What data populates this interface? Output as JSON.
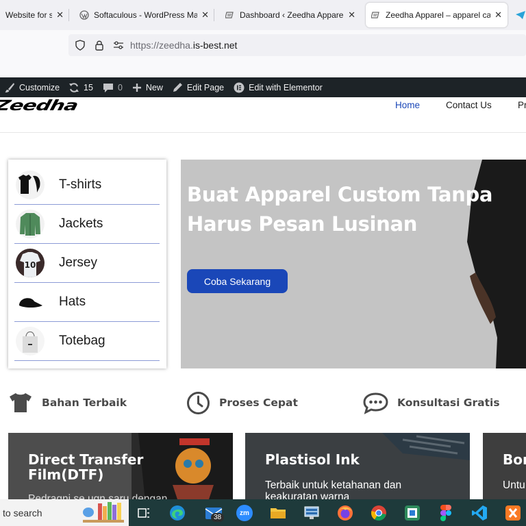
{
  "browser": {
    "tabs": [
      {
        "title": "Website for sketch",
        "favicon": "page-icon"
      },
      {
        "title": "Softaculous - WordPress Manage",
        "favicon": "wordpress-icon"
      },
      {
        "title": "Dashboard ‹ Zeedha Apparel",
        "favicon": "page-icon"
      },
      {
        "title": "Zeedha Apparel – apparel catalog",
        "favicon": "page-icon",
        "active": true
      }
    ],
    "close_glyph": "✕",
    "url_scheme": "https://zeedha.",
    "url_host": "is-best.net"
  },
  "wp_admin_bar": {
    "customize": "Customize",
    "updates_count": "15",
    "comments_count": "0",
    "new": "New",
    "edit_page": "Edit Page",
    "edit_elementor": "Edit with Elementor"
  },
  "site": {
    "logo": "Zeedha",
    "nav": [
      "Home",
      "Contact Us",
      "Pr"
    ],
    "active_nav": "Home",
    "categories": [
      "T-shirts",
      "Jackets",
      "Jersey",
      "Hats",
      "Totebag"
    ],
    "hero": {
      "title": "Buat Apparel Custom Tanpa Harus Pesan Lusinan",
      "button": "Coba Sekarang"
    },
    "features": [
      "Bahan Terbaik",
      "Proses Cepat",
      "Konsultasi Gratis"
    ],
    "cards": [
      {
        "title": "Direct Transfer Film(DTF)",
        "desc": "Pedragni se ugn saru dengan"
      },
      {
        "title": "Plastisol Ink",
        "desc": "Terbaik untuk ketahanan dan keakuratan warna"
      },
      {
        "title": "Bor",
        "desc": "Untu"
      }
    ]
  },
  "taskbar": {
    "search_text": "to search",
    "mail_badge": "38",
    "zoom_label": "zm"
  },
  "colors": {
    "accent": "#1a47b8",
    "admin_bar": "#1d2327",
    "hero_bg": "#c4c4c4",
    "taskbar": "#1e3a3b"
  }
}
